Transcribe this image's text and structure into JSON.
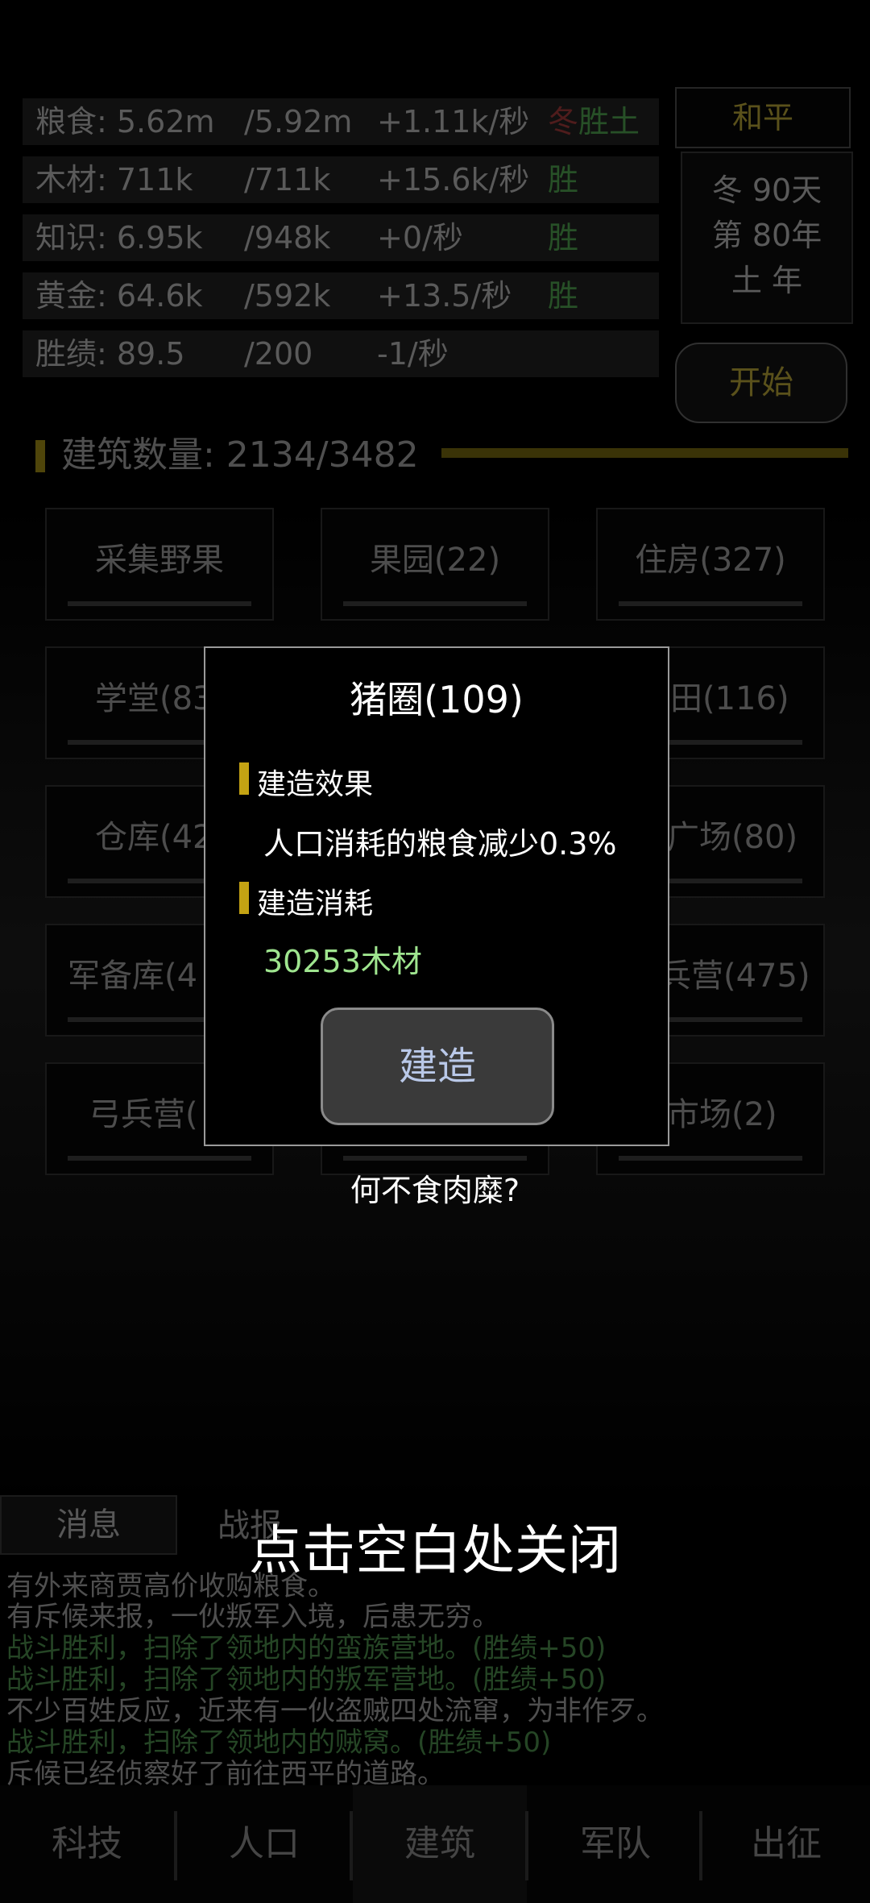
{
  "resources": [
    {
      "name": "粮食: 5.62m",
      "cap": "/5.92m",
      "rate": "+1.11k/秒",
      "status_red": "冬",
      "status": "胜土"
    },
    {
      "name": "木材: 711k",
      "cap": "/711k",
      "rate": "+15.6k/秒",
      "status_red": "",
      "status": "胜"
    },
    {
      "name": "知识: 6.95k",
      "cap": "/948k",
      "rate": "+0/秒",
      "status_red": "",
      "status": "胜"
    },
    {
      "name": "黄金: 64.6k",
      "cap": "/592k",
      "rate": "+13.5/秒",
      "status_red": "",
      "status": "胜"
    },
    {
      "name": "胜绩: 89.5",
      "cap": "/200",
      "rate": "-1/秒",
      "status_red": "",
      "status": ""
    }
  ],
  "state_label": "和平",
  "calendar": {
    "line1": "冬 90天",
    "line2": "第 80年",
    "line3": "土 年"
  },
  "start_button": "开始",
  "buildings_header": "建筑数量: 2134/3482",
  "buildings": [
    {
      "label": "采集野果"
    },
    {
      "label": "果园(22)"
    },
    {
      "label": "住房(327)"
    },
    {
      "label": "学堂(83"
    },
    {
      "label": ""
    },
    {
      "label": "田(116)"
    },
    {
      "label": "仓库(42"
    },
    {
      "label": ""
    },
    {
      "label": "广场(80)"
    },
    {
      "label": "军备库(4"
    },
    {
      "label": ""
    },
    {
      "label": "兵营(475)"
    },
    {
      "label": "弓兵营("
    },
    {
      "label": ""
    },
    {
      "label": "市场(2)"
    }
  ],
  "bottom_tabs": {
    "messages": "消息",
    "battle": "战报"
  },
  "log": [
    {
      "text": "有外来商贾高价收购粮食。",
      "green": false
    },
    {
      "text": "有斥候来报，一伙叛军入境，后患无穷。",
      "green": false
    },
    {
      "text": "战斗胜利，扫除了领地内的蛮族营地。(胜绩+50)",
      "green": true
    },
    {
      "text": "战斗胜利，扫除了领地内的叛军营地。(胜绩+50)",
      "green": true
    },
    {
      "text": "不少百姓反应，近来有一伙盗贼四处流窜，为非作歹。",
      "green": false
    },
    {
      "text": "战斗胜利，扫除了领地内的贼窝。(胜绩+50)",
      "green": true
    },
    {
      "text": "斥候已经侦察好了前往西平的道路。",
      "green": false
    }
  ],
  "nav": [
    "科技",
    "人口",
    "建筑",
    "军队",
    "出征"
  ],
  "modal": {
    "title": "猪圈(109)",
    "effect_header": "建造效果",
    "effect_text": "人口消耗的粮食减少0.3%",
    "cost_header": "建造消耗",
    "cost_text": "30253木材",
    "build_button": "建造",
    "flavor": "何不食肉糜?",
    "close_hint": "点击空白处关闭"
  }
}
